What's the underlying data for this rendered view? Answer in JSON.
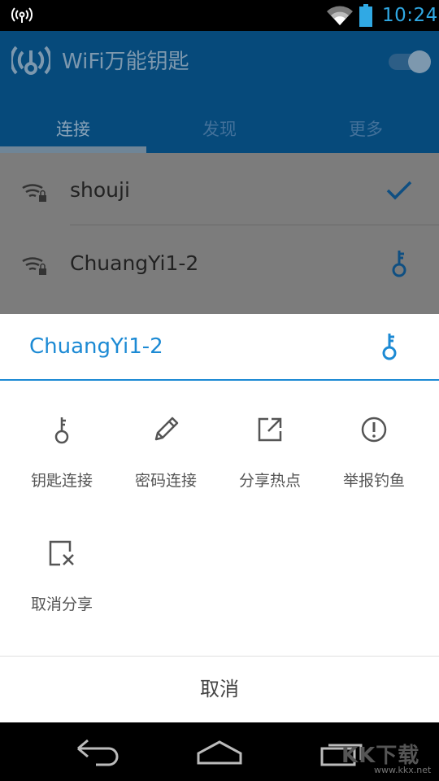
{
  "status_bar": {
    "time": "10:24",
    "time_color": "#30a9e4"
  },
  "app": {
    "title": "WiFi万能钥匙",
    "header_color": "#064a7b",
    "tabs": [
      {
        "label": "连接",
        "active": true
      },
      {
        "label": "发现",
        "active": false
      },
      {
        "label": "更多",
        "active": false
      }
    ],
    "toggle_on": true
  },
  "wifi_list": [
    {
      "name": "shouji",
      "status_icon": "check-icon"
    },
    {
      "name": "ChuangYi1-2",
      "status_icon": "key-icon"
    }
  ],
  "sheet": {
    "title": "ChuangYi1-2",
    "accent_color": "#1c8ad4",
    "actions": [
      {
        "label": "钥匙连接",
        "icon": "key-icon"
      },
      {
        "label": "密码连接",
        "icon": "pencil-icon"
      },
      {
        "label": "分享热点",
        "icon": "share-external-icon"
      },
      {
        "label": "举报钓鱼",
        "icon": "alert-circle-icon"
      },
      {
        "label": "取消分享",
        "icon": "unshare-icon"
      }
    ],
    "cancel_label": "取消"
  },
  "watermark": {
    "text": "KK下载",
    "url": "www.kkx.net"
  }
}
